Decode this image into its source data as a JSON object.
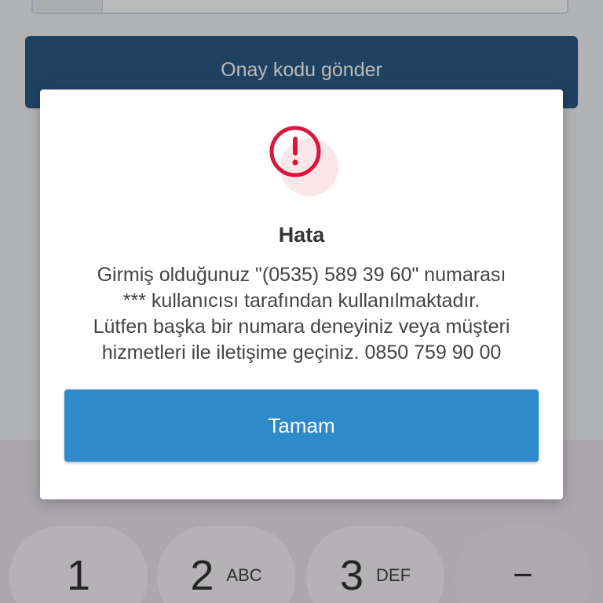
{
  "background": {
    "send_code_button_label": "Onay kodu gönder",
    "keypad": {
      "keys": [
        {
          "digit": "1",
          "letters": ""
        },
        {
          "digit": "2",
          "letters": "ABC"
        },
        {
          "digit": "3",
          "letters": "DEF"
        },
        {
          "digit": "−",
          "letters": ""
        }
      ]
    }
  },
  "dialog": {
    "icon": "alert-circle-icon",
    "title": "Hata",
    "message_lines": [
      "Girmiş olduğunuz \"(0535) 589 39 60\" numarası",
      "*** kullanıcısı tarafından kullanılmaktadır.",
      "Lütfen başka bir numara deneyiniz veya müşteri",
      "hizmetleri ile iletişime geçiniz. 0850 759 90 00"
    ],
    "ok_button_label": "Tamam"
  },
  "colors": {
    "accent": "#2e8ac9",
    "primary_dark": "#1d4f7c",
    "error": "#d8163f"
  }
}
